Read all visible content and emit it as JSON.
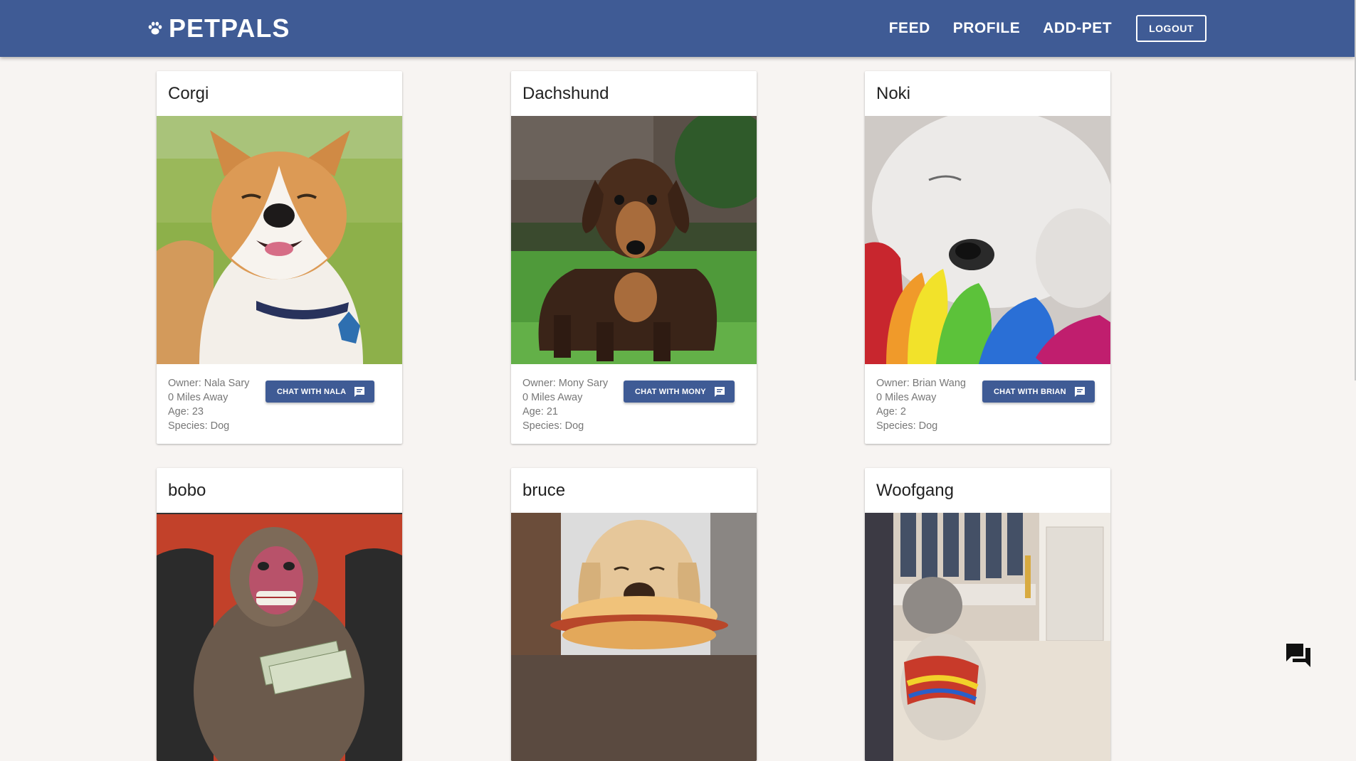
{
  "app": {
    "name": "PETPALS",
    "logo_icon": "paw-icon",
    "brand_color": "#3f5b95",
    "background": "#f7f4f2"
  },
  "nav": {
    "feed": "FEED",
    "profile": "PROFILE",
    "add_pet": "ADD-PET",
    "logout": "LOGOUT"
  },
  "pets": [
    {
      "name": "Corgi",
      "owner": "Owner: Nala Sary",
      "distance": "0 Miles Away",
      "age": "Age: 23",
      "species": "Species: Dog",
      "chat": "CHAT WITH NALA",
      "photo": "smiling corgi with blue collar"
    },
    {
      "name": "Dachshund",
      "owner": "Owner: Mony Sary",
      "distance": "0 Miles Away",
      "age": "Age: 21",
      "species": "Species: Dog",
      "chat": "CHAT WITH MONY",
      "photo": "dachshund standing in grass"
    },
    {
      "name": "Noki",
      "owner": "Owner: Brian Wang",
      "distance": "0 Miles Away",
      "age": "Age: 2",
      "species": "Species: Dog",
      "chat": "CHAT WITH BRIAN",
      "photo": "white puppy sleeping on rainbow toy"
    },
    {
      "name": "bobo",
      "photo": "monkey holding money"
    },
    {
      "name": "bruce",
      "photo": "dog holding hot dog in mouth"
    },
    {
      "name": "Woofgang",
      "photo": "small dog in decorated room"
    }
  ],
  "floating_action": {
    "icon": "forum-chat-icon"
  }
}
